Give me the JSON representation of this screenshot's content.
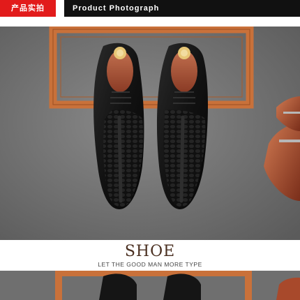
{
  "header": {
    "badge_label": "产品实拍",
    "title": "Product Photograph"
  },
  "photo": {
    "subject": "black crocodile-embossed oxford shoes with wooden shoe trees"
  },
  "caption": {
    "title": "SHOE",
    "subtitle": "LET THE GOOD MAN MORE TYPE"
  },
  "colors": {
    "badge": "#e21b1b",
    "title_bar": "#111111",
    "background_gray": "#6f6f6f",
    "frame_orange": "#c9713a",
    "caption_brown": "#4a2f20"
  }
}
